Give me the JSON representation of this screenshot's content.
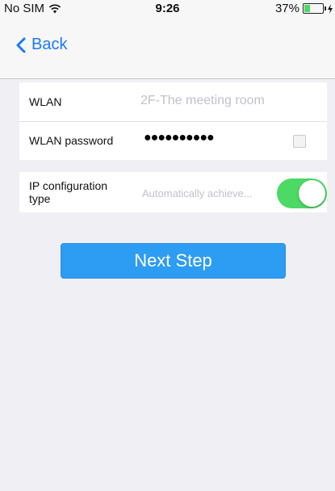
{
  "status_bar": {
    "carrier": "No SIM",
    "time": "9:26",
    "battery_percent_label": "37%",
    "battery_level": 0.37,
    "battery_fill_color": "#4cd964",
    "icons": [
      "wifi-icon",
      "battery-icon",
      "charging-icon"
    ]
  },
  "nav": {
    "back_label": "Back",
    "back_icon": "chevron-left-icon",
    "accent_color": "#1a7af8"
  },
  "form": {
    "wlan": {
      "label": "WLAN",
      "value": "2F-The meeting room"
    },
    "password": {
      "label": "WLAN password",
      "value": "●●●●●●●●●●",
      "show_password_checked": false
    },
    "ip_config": {
      "label": "IP configuration type",
      "value": "Automatically achieve...",
      "toggle_on": true,
      "toggle_color": "#4cd964"
    }
  },
  "actions": {
    "next_step_label": "Next Step",
    "button_color": "#2d9cf3"
  }
}
